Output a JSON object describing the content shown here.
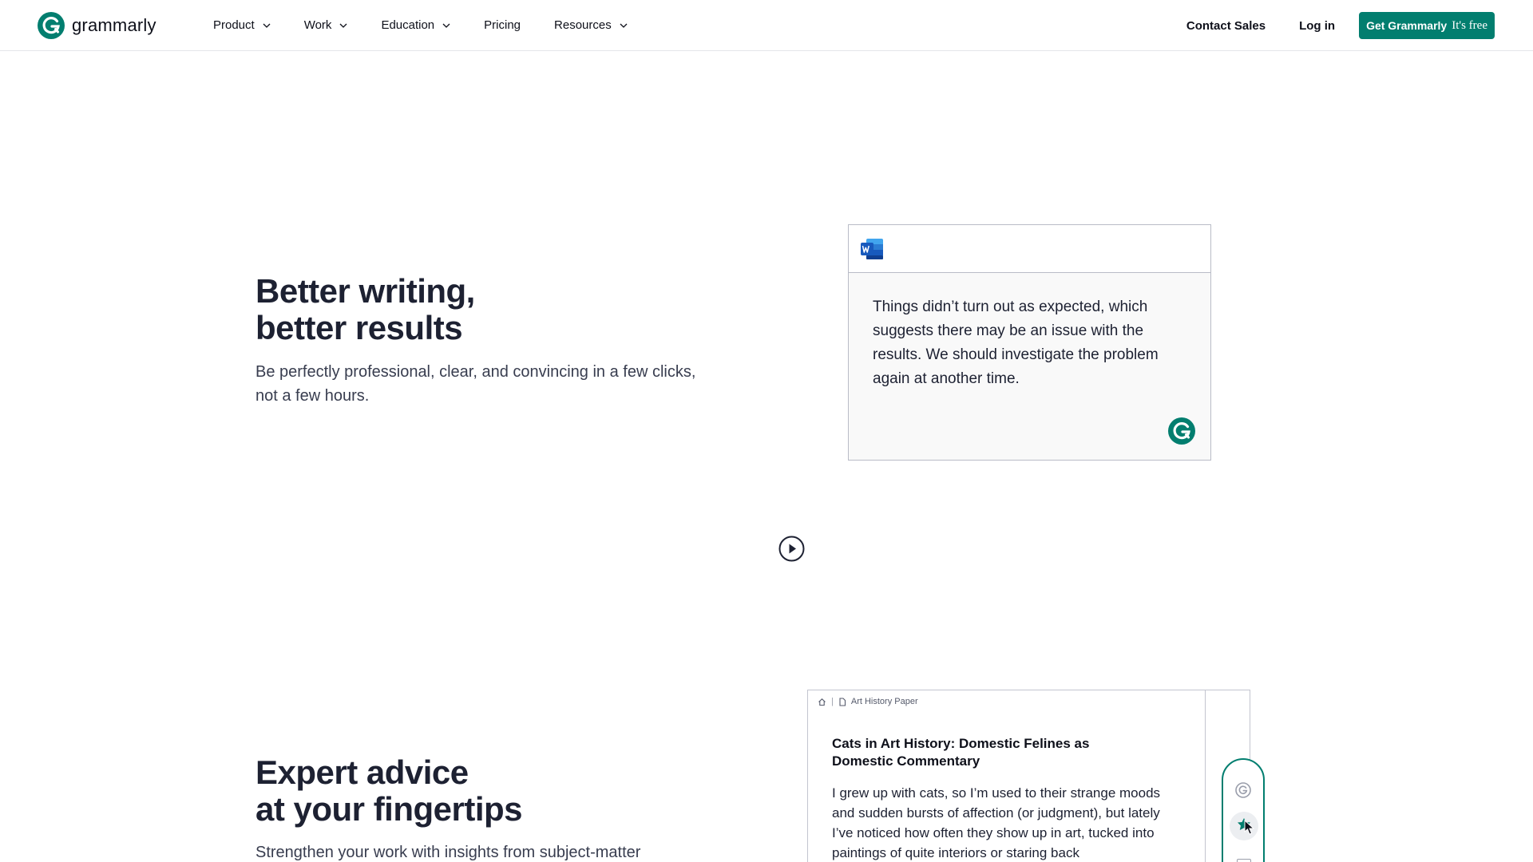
{
  "nav": {
    "logo_text": "grammarly",
    "links": [
      {
        "label": "Product",
        "dropdown": true
      },
      {
        "label": "Work",
        "dropdown": true
      },
      {
        "label": "Education",
        "dropdown": true
      },
      {
        "label": "Pricing",
        "dropdown": false
      },
      {
        "label": "Resources",
        "dropdown": true
      }
    ],
    "contact_label": "Contact Sales",
    "login_label": "Log in",
    "cta_main": "Get Grammarly",
    "cta_sub": "It's free"
  },
  "hero": {
    "title_line1": "Better writing,",
    "title_line2": "better results",
    "subtitle": "Be perfectly professional, clear, and convincing in a few clicks, not a few hours.",
    "word_card_text": "Things didn’t turn out as expected, which suggests there may be an issue with the results. We should investigate the problem again at another time."
  },
  "expert": {
    "title_line1": "Expert advice",
    "title_line2": "at your fingertips",
    "subtitle": "Strengthen your work with insights from subject-matter",
    "doc_breadcrumb": "Art History Paper",
    "doc_title": "Cats in Art History: Domestic Felines as Domestic Commentary",
    "doc_body": "I grew up with cats, so I’m used to their strange moods and sudden bursts of affection (or judgment), but lately I’ve noticed how often they show up in art, tucked into paintings of quite interiors or staring back"
  },
  "colors": {
    "brand_green": "#027e6f",
    "word_blue": "#185abd",
    "heading": "#1d2132"
  },
  "icons": [
    "grammarly-logo-icon",
    "chevron-down-icon",
    "word-app-icon",
    "grammarly-badge-icon",
    "play-icon",
    "home-icon",
    "document-icon",
    "cursor-icon"
  ]
}
